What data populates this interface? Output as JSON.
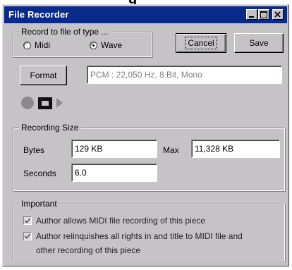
{
  "window": {
    "title": "File Recorder"
  },
  "record_type": {
    "legend": "Record to file of type ...",
    "options": [
      {
        "label": "Midi",
        "selected": false
      },
      {
        "label": "Wave",
        "selected": true
      }
    ]
  },
  "buttons": {
    "cancel": "Cancel",
    "save": "Save",
    "format": "Format"
  },
  "format_info": "PCM : 22,050 Hz, 8 Bit, Mono",
  "transport": {
    "icons": [
      "record-icon",
      "stop-icon",
      "play-icon"
    ]
  },
  "recording_size": {
    "legend": "Recording Size",
    "bytes_label": "Bytes",
    "bytes_value": "129 KB",
    "max_label": "Max",
    "max_value": "11,328 KB",
    "seconds_label": "Seconds",
    "seconds_value": "6.0"
  },
  "important": {
    "legend": "Important",
    "items": [
      {
        "text": "Author allows MIDI file recording of this piece",
        "checked": true
      },
      {
        "text": "Author relinquishes all rights in and title to MIDI file and other recording of this piece",
        "checked": true
      }
    ]
  },
  "colors": {
    "title_bar": "#0a2a8a",
    "window_face": "#c6c3c6"
  }
}
